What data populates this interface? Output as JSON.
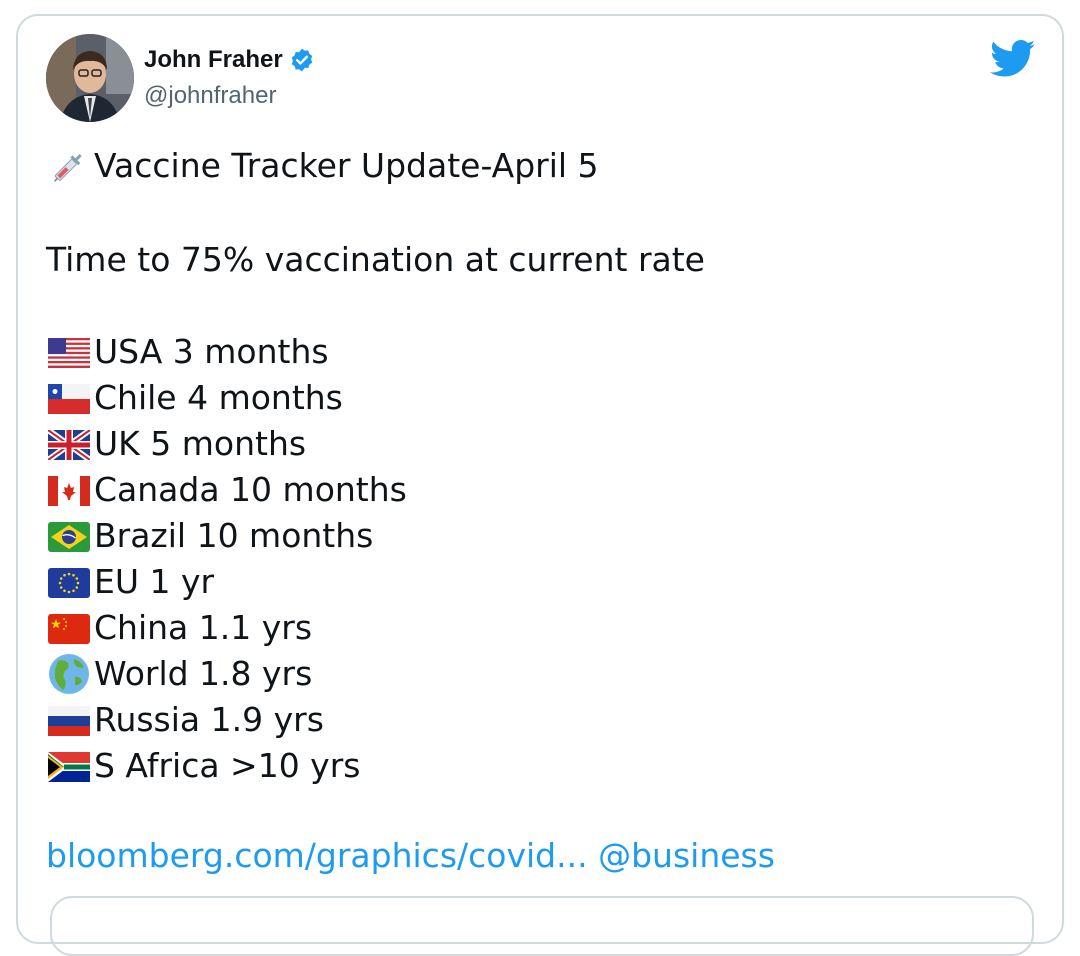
{
  "author": {
    "name": "John Fraher",
    "handle": "@johnfraher",
    "verified": true
  },
  "tweet": {
    "title": "Vaccine Tracker Update-April 5",
    "title_icon": "syringe-icon",
    "subtitle": "Time to 75% vaccination at current rate",
    "rows": [
      {
        "flag": "usa-flag-icon",
        "text": "USA 3 months"
      },
      {
        "flag": "chile-flag-icon",
        "text": "Chile 4 months"
      },
      {
        "flag": "uk-flag-icon",
        "text": "UK 5 months"
      },
      {
        "flag": "canada-flag-icon",
        "text": "Canada 10 months"
      },
      {
        "flag": "brazil-flag-icon",
        "text": "Brazil 10 months"
      },
      {
        "flag": "eu-flag-icon",
        "text": "EU 1 yr"
      },
      {
        "flag": "china-flag-icon",
        "text": "China 1.1 yrs"
      },
      {
        "flag": "globe-icon",
        "text": "World 1.8 yrs"
      },
      {
        "flag": "russia-flag-icon",
        "text": "Russia 1.9 yrs"
      },
      {
        "flag": "south-africa-flag-icon",
        "text": "S Africa >10 yrs"
      }
    ],
    "link": "bloomberg.com/graphics/covid...",
    "mention": "@business"
  },
  "colors": {
    "link": "#1d9bf0",
    "twitter_blue": "#1d9bf0",
    "text": "#0f1419",
    "secondary": "#536471"
  }
}
